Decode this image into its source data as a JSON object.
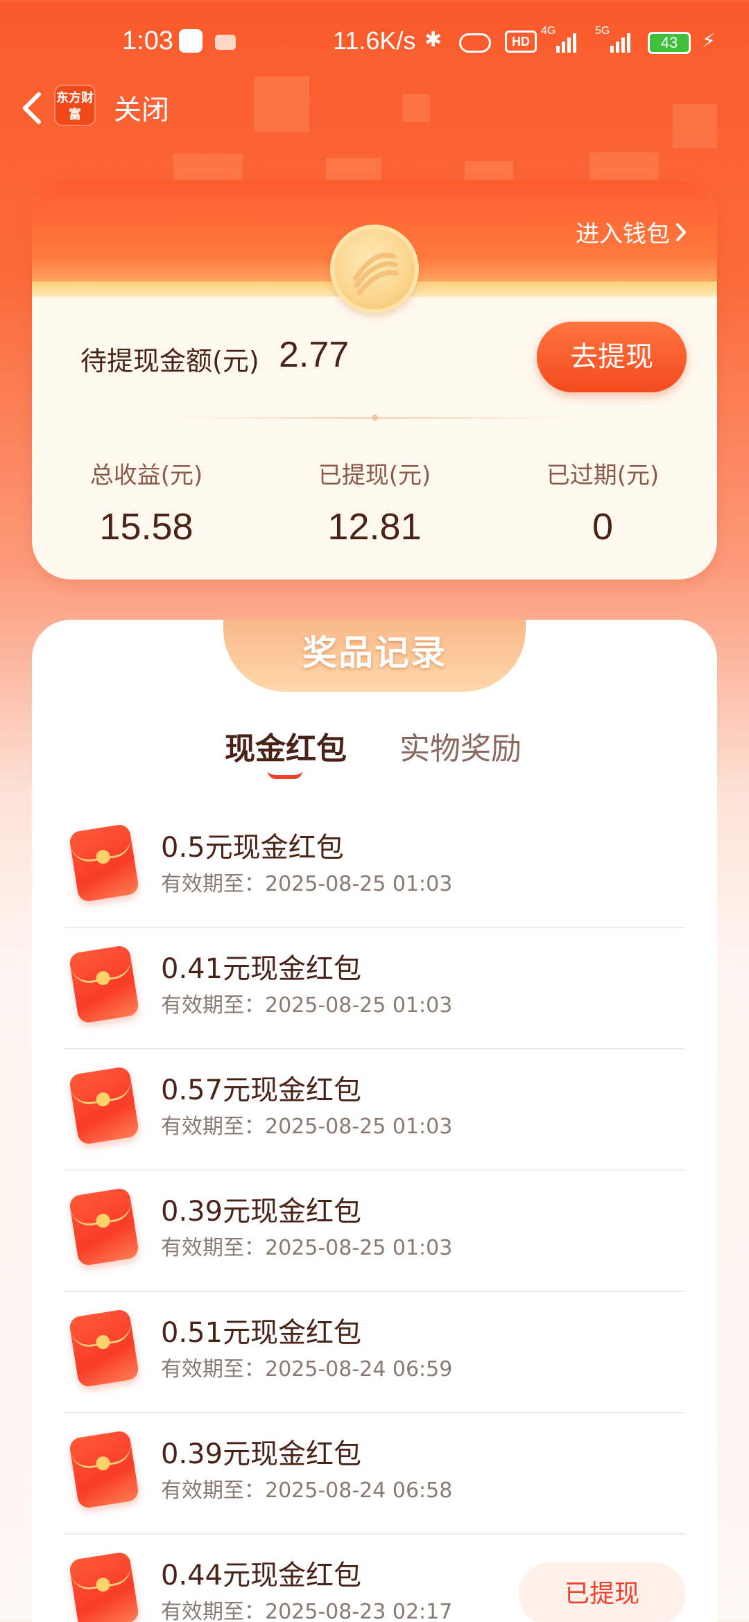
{
  "status_bar": {
    "time": "1:03",
    "net_speed": "11.6K/s",
    "hd_label": "HD",
    "network_1": "4G",
    "network_2": "5G",
    "battery": "43"
  },
  "nav": {
    "brand": "东方财富",
    "close_label": "关闭"
  },
  "wallet": {
    "enter_label": "进入钱包",
    "pending_label": "待提现金额(元)",
    "pending_value": "2.77",
    "withdraw_label": "去提现",
    "stats": [
      {
        "label": "总收益(元)",
        "value": "15.58"
      },
      {
        "label": "已提现(元)",
        "value": "12.81"
      },
      {
        "label": "已过期(元)",
        "value": "0"
      }
    ]
  },
  "records": {
    "title": "奖品记录",
    "tabs": [
      {
        "label": "现金红包",
        "active": true
      },
      {
        "label": "实物奖励",
        "active": false
      }
    ],
    "items": [
      {
        "title": "0.5元现金红包",
        "expiry": "有效期至：2025-08-25 01:03",
        "status": ""
      },
      {
        "title": "0.41元现金红包",
        "expiry": "有效期至：2025-08-25 01:03",
        "status": ""
      },
      {
        "title": "0.57元现金红包",
        "expiry": "有效期至：2025-08-25 01:03",
        "status": ""
      },
      {
        "title": "0.39元现金红包",
        "expiry": "有效期至：2025-08-25 01:03",
        "status": ""
      },
      {
        "title": "0.51元现金红包",
        "expiry": "有效期至：2025-08-24 06:59",
        "status": ""
      },
      {
        "title": "0.39元现金红包",
        "expiry": "有效期至：2025-08-24 06:58",
        "status": ""
      },
      {
        "title": "0.44元现金红包",
        "expiry": "有效期至：2025-08-23 02:17",
        "status": "已提现"
      }
    ]
  },
  "colors": {
    "brand_orange": "#fa5a2c",
    "accent_red": "#f0402a",
    "text_dark": "#4a2318"
  },
  "icons": [
    "back-icon",
    "chevron-right-icon",
    "bluetooth-icon",
    "battery-icon",
    "red-envelope-icon",
    "medal-icon"
  ]
}
